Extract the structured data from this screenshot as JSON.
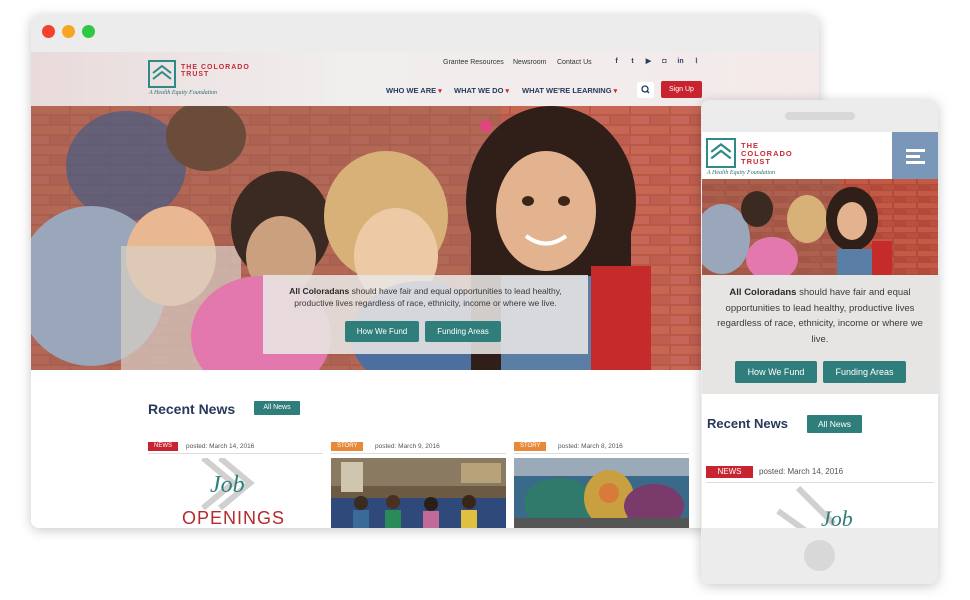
{
  "site": {
    "logo_name": "THE COLORADO TRUST",
    "logo_tagline": "A Health Equity Foundation"
  },
  "utility_nav": [
    "Grantee Resources",
    "Newsroom",
    "Contact Us"
  ],
  "social_icons": [
    "facebook-icon",
    "twitter-icon",
    "youtube-icon",
    "instagram-icon",
    "linkedin-icon",
    "rss-icon"
  ],
  "main_nav": [
    "WHO WE ARE",
    "WHAT WE DO",
    "WHAT WE'RE LEARNING"
  ],
  "signup_label": "Sign Up",
  "hero": {
    "bold": "All Coloradans",
    "text": " should have fair and equal opportunities to lead healthy, productive lives regardless of race, ethnicity, income or where we live.",
    "buttons": [
      "How We Fund",
      "Funding Areas"
    ]
  },
  "news": {
    "title": "Recent News",
    "all_label": "All News",
    "cards": [
      {
        "tag": "NEWS",
        "posted": "posted: March 14, 2016",
        "tag_color": "#c8242f",
        "thumb_line1": "Job",
        "thumb_line2": "OPENINGS"
      },
      {
        "tag": "STORY",
        "posted": "posted: March 9, 2016",
        "tag_color": "#e8893a"
      },
      {
        "tag": "STORY",
        "posted": "posted: March 8, 2016",
        "tag_color": "#e8893a"
      }
    ]
  },
  "mobile": {
    "news_title": "Recent News",
    "all_label": "All News",
    "first_card": {
      "tag": "NEWS",
      "posted": "posted: March 14, 2016",
      "thumb_word": "Job"
    }
  },
  "colors": {
    "accent_red": "#c8242f",
    "teal": "#2f7e7b",
    "navy": "#263a5a",
    "story_orange": "#e8893a"
  }
}
